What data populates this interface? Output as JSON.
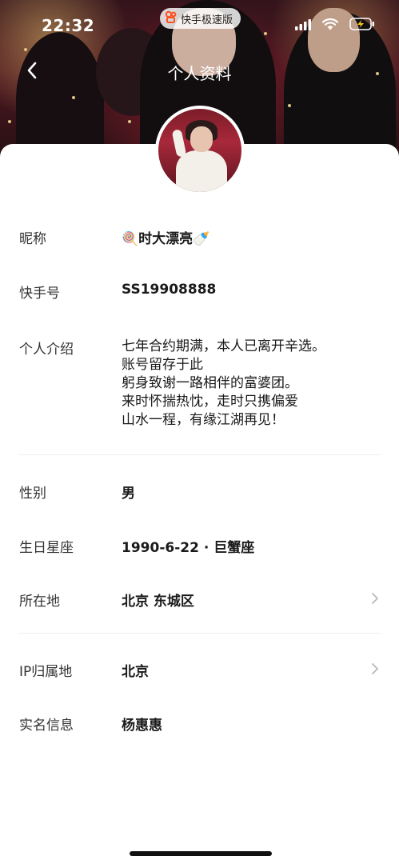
{
  "status_bar": {
    "time": "22:32",
    "app_badge": "快手极速版"
  },
  "nav": {
    "title": "个人资料"
  },
  "profile": {
    "rows": [
      {
        "label": "昵称",
        "value": "🍭时大漂亮🍼"
      },
      {
        "label": "快手号",
        "value": "SS19908888"
      },
      {
        "label": "个人介绍",
        "value_lines": [
          "七年合约期满，本人已离开辛选。",
          "账号留存于此",
          "躬身致谢一路相伴的富婆团。",
          "来时怀揣热忱，走时只携偏爱",
          "山水一程，有缘江湖再见！"
        ]
      },
      {
        "label": "性别",
        "value": "男"
      },
      {
        "label": "生日星座",
        "value": "1990-6-22 · 巨蟹座"
      },
      {
        "label": "所在地",
        "value": "北京 东城区"
      },
      {
        "label": "IP归属地",
        "value": "北京"
      },
      {
        "label": "实名信息",
        "value": "杨惠惠"
      }
    ]
  },
  "icons": {
    "back": "chevron-left-icon",
    "signal": "signal-icon",
    "wifi": "wifi-icon",
    "battery": "battery-charging-icon",
    "row_chevron": "chevron-right-icon"
  },
  "colors": {
    "battery_accent": "#f5c518",
    "divider": "#eeeeee",
    "chevron": "#b8b8b8"
  }
}
